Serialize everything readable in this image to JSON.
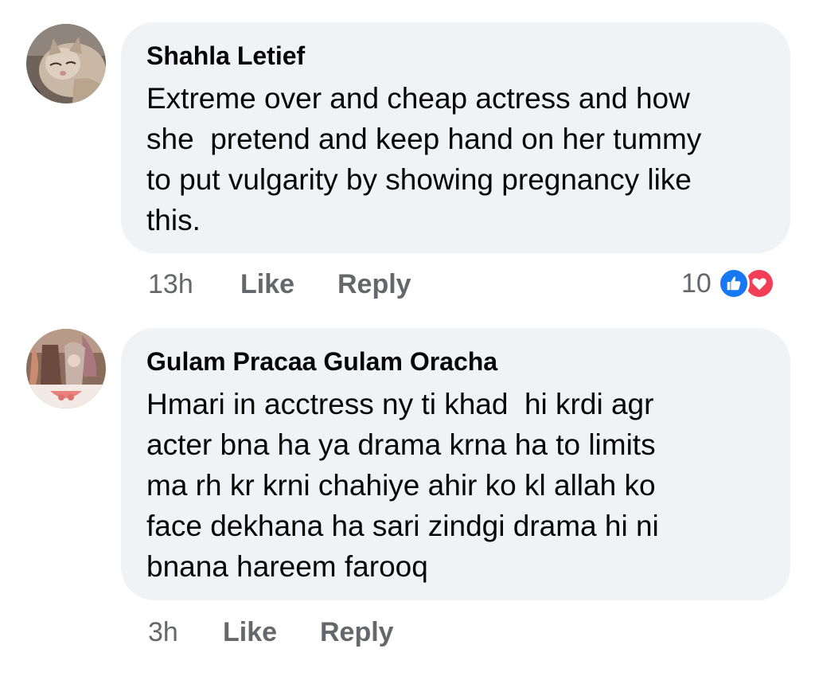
{
  "colors": {
    "bubble_bg": "#f0f2f5",
    "text": "#050505",
    "meta": "#65676b",
    "like_blue": "#1877f2",
    "love_red": "#f33e58"
  },
  "comments": [
    {
      "author": "Shahla Letief",
      "lines": [
        "Extreme over and cheap actress and how",
        "she  pretend and keep hand on her tummy",
        "to put vulgarity by showing pregnancy like",
        "this."
      ],
      "time": "13h",
      "like_label": "Like",
      "reply_label": "Reply",
      "reaction_count": "10",
      "reaction_icons": [
        "like-icon",
        "love-icon"
      ]
    },
    {
      "author": "Gulam Pracaa Gulam Oracha",
      "lines": [
        "Hmari in acctress ny ti khad  hi krdi agr",
        "acter bna ha ya drama krna ha to limits",
        "ma rh kr krni chahiye ahir ko kl allah ko",
        "face dekhana ha sari zindgi drama hi ni",
        "bnana hareem farooq"
      ],
      "time": "3h",
      "like_label": "Like",
      "reply_label": "Reply"
    }
  ]
}
